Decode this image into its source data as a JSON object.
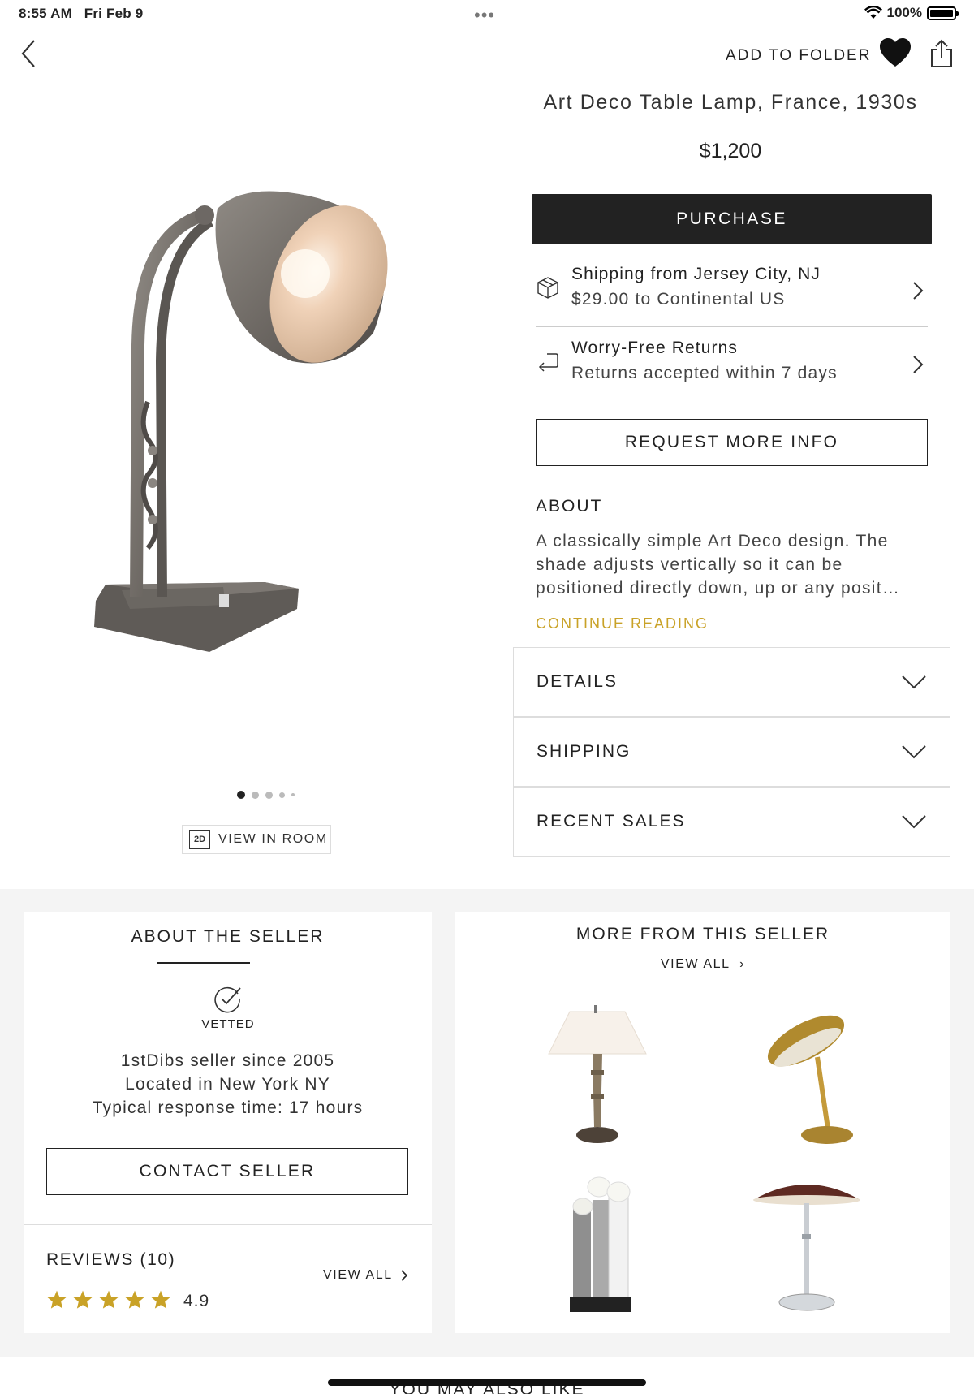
{
  "status_bar": {
    "time": "8:55 AM",
    "date": "Fri Feb 9",
    "battery": "100%"
  },
  "header": {
    "add_to_folder": "ADD TO FOLDER"
  },
  "product": {
    "title": "Art Deco Table Lamp, France, 1930s",
    "price": "$1,200",
    "purchase_label": "PURCHASE",
    "view_in_room": "VIEW IN ROOM",
    "view_in_room_badge": "2D",
    "image_pages": 5,
    "current_page": 1
  },
  "shipping_row": {
    "line1": "Shipping from Jersey City, NJ",
    "line2": "$29.00 to Continental US"
  },
  "returns_row": {
    "line1": "Worry-Free Returns",
    "line2": "Returns accepted within 7 days"
  },
  "request_info_label": "REQUEST MORE INFO",
  "about": {
    "heading": "ABOUT",
    "text": "A classically simple Art Deco design. The shade adjusts vertically so it can be positioned directly down, up or any posit…",
    "continue_label": "CONTINUE READING"
  },
  "accordions": [
    {
      "label": "DETAILS"
    },
    {
      "label": "SHIPPING"
    },
    {
      "label": "RECENT SALES"
    }
  ],
  "seller": {
    "heading": "ABOUT THE SELLER",
    "vetted": "VETTED",
    "since": "1stDibs seller since 2005",
    "location": "Located in New York NY",
    "response": "Typical response time: 17 hours",
    "contact_label": "CONTACT SELLER",
    "reviews_label": "REVIEWS (10)",
    "reviews_view_all": "VIEW ALL",
    "rating": "4.9",
    "stars": 5
  },
  "more_from_seller": {
    "heading": "MORE FROM THIS SELLER",
    "view_all": "VIEW ALL"
  },
  "footer": {
    "also_like": "YOU MAY ALSO LIKE"
  },
  "colors": {
    "accent_gold": "#c9a227",
    "button_dark": "#222222",
    "star": "#c9a227"
  }
}
